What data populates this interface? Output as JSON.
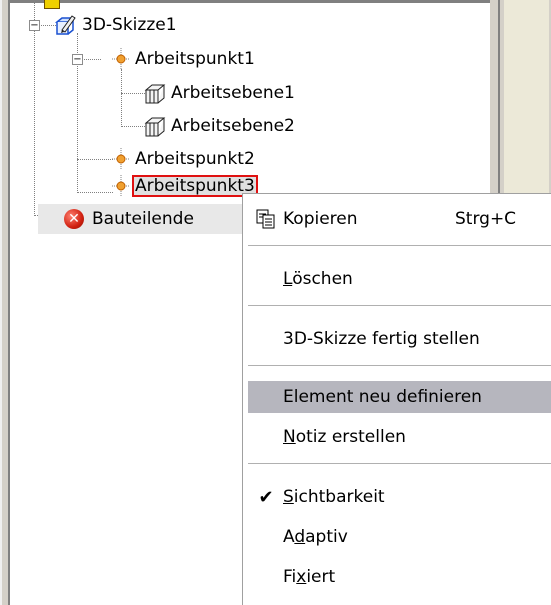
{
  "tree": {
    "root": {
      "label": "3D-Skizze1",
      "expander": "−"
    },
    "children": [
      {
        "label": "Arbeitspunkt1",
        "expander": "−",
        "children": [
          {
            "label": "Arbeitsebene1"
          },
          {
            "label": "Arbeitsebene2"
          }
        ]
      },
      {
        "label": "Arbeitspunkt2"
      },
      {
        "label": "Arbeitspunkt3",
        "selected": true
      }
    ],
    "end": {
      "label": "Bauteilende",
      "icon": "error-x-icon",
      "glyph": "✕"
    }
  },
  "context_menu": {
    "copy": {
      "label": "Kopieren",
      "shortcut": "Strg+C",
      "icon": "copy-icon"
    },
    "delete": {
      "label_pre": "",
      "label_mn": "L",
      "label_post": "öschen"
    },
    "finish_sketch": {
      "label": "3D-Skizze fertig stellen"
    },
    "redefine": {
      "label": "Element neu definieren",
      "highlighted": true
    },
    "note": {
      "label_pre": "",
      "label_mn": "N",
      "label_post": "otiz erstellen"
    },
    "visibility": {
      "label_pre": "",
      "label_mn": "S",
      "label_post": "ichtbarkeit",
      "checked": true,
      "check_glyph": "✔"
    },
    "adaptive": {
      "label_pre": "A",
      "label_mn": "d",
      "label_post": "aptiv"
    },
    "fixed": {
      "label_pre": "Fi",
      "label_mn": "x",
      "label_post": "iert"
    }
  },
  "colors": {
    "highlight": "#b6b6be",
    "selection_outline": "#e01010",
    "frame": "#d4d0c8"
  }
}
